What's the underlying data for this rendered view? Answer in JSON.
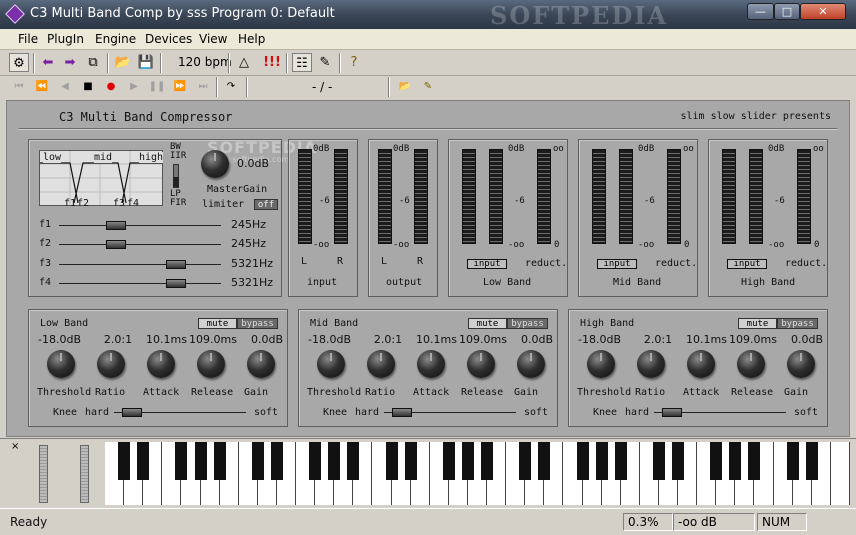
{
  "window": {
    "title": "C3 Multi Band Comp by sss Program 0: Default",
    "watermark": "SOFTPEDIA",
    "buttons": [
      "minimize",
      "maximize",
      "close"
    ]
  },
  "menu": [
    "File",
    "PlugIn",
    "Engine",
    "Devices",
    "View",
    "Help"
  ],
  "toolbar": {
    "bpm": "120 bpm",
    "position": "- / -",
    "icons": [
      "settings-icon",
      "back-arrow-icon",
      "forward-arrow-icon",
      "copy-icon",
      "open-icon",
      "save-icon",
      "metronome-icon",
      "alert-icon",
      "piano-icon",
      "keyboard-edit-icon",
      "help-icon"
    ],
    "transport": [
      "rewind-start-icon",
      "rewind-icon",
      "back-icon",
      "stop-icon",
      "record-icon",
      "play-icon",
      "pause-icon",
      "forward-icon",
      "forward-end-icon",
      "loop-icon",
      "open-icon",
      "edit-icon"
    ]
  },
  "plugin": {
    "title": "C3 Multi Band Compressor",
    "subtitle": "slim slow slider presents",
    "watermark_sub": "SOFTPEDIA",
    "watermark_url": "www.softpedia.com",
    "crossover": {
      "bands": [
        "low",
        "mid",
        "high"
      ],
      "markers": [
        "f1",
        "f2",
        "f3",
        "f4"
      ],
      "filter_top": "BW\nIIR",
      "filter_bottom": "LP\nFIR",
      "master_gain_value": "0.0dB",
      "master_gain_label": "MasterGain",
      "limiter_label": "limiter",
      "limiter_state": "off",
      "freq_labels": [
        "f1",
        "f2",
        "f3",
        "f4"
      ],
      "freq_values": [
        "245Hz",
        "245Hz",
        "5321Hz",
        "5321Hz"
      ],
      "freq_positions": [
        0.31,
        0.31,
        0.71,
        0.71
      ]
    },
    "meters": {
      "scale": [
        "0dB",
        "-6",
        "-oo"
      ],
      "input": {
        "channels": [
          "L",
          "R"
        ],
        "name": "input"
      },
      "output": {
        "channels": [
          "L",
          "R"
        ],
        "name": "output"
      },
      "bands": [
        {
          "name": "Low Band",
          "btn": "input",
          "reduct": "reduct.",
          "top": "oo",
          "bottom": "0"
        },
        {
          "name": "Mid Band",
          "btn": "input",
          "reduct": "reduct.",
          "top": "oo",
          "bottom": "0"
        },
        {
          "name": "High Band",
          "btn": "input",
          "reduct": "reduct.",
          "top": "oo",
          "bottom": "0"
        }
      ]
    },
    "band_sections": [
      {
        "name": "Low Band",
        "mute": "mute",
        "bypass": "bypass",
        "values": [
          "-18.0dB",
          "2.0:1",
          "10.1ms",
          "109.0ms",
          "0.0dB"
        ],
        "labels": [
          "Threshold",
          "Ratio",
          "Attack",
          "Release",
          "Gain"
        ],
        "knee": "Knee",
        "hard": "hard",
        "soft": "soft",
        "knee_position": 0.25
      },
      {
        "name": "Mid Band",
        "mute": "mute",
        "bypass": "bypass",
        "values": [
          "-18.0dB",
          "2.0:1",
          "10.1ms",
          "109.0ms",
          "0.0dB"
        ],
        "labels": [
          "Threshold",
          "Ratio",
          "Attack",
          "Release",
          "Gain"
        ],
        "knee": "Knee",
        "hard": "hard",
        "soft": "soft",
        "knee_position": 0.25
      },
      {
        "name": "High Band",
        "mute": "mute",
        "bypass": "bypass",
        "values": [
          "-18.0dB",
          "2.0:1",
          "10.1ms",
          "109.0ms",
          "0.0dB"
        ],
        "labels": [
          "Threshold",
          "Ratio",
          "Attack",
          "Release",
          "Gain"
        ],
        "knee": "Knee",
        "hard": "hard",
        "soft": "soft",
        "knee_position": 0.25
      }
    ]
  },
  "keyboard": {
    "close": "×",
    "white_keys": 39
  },
  "status": {
    "text": "Ready",
    "cpu": "0.3%",
    "level": "-oo dB",
    "num": "NUM"
  }
}
